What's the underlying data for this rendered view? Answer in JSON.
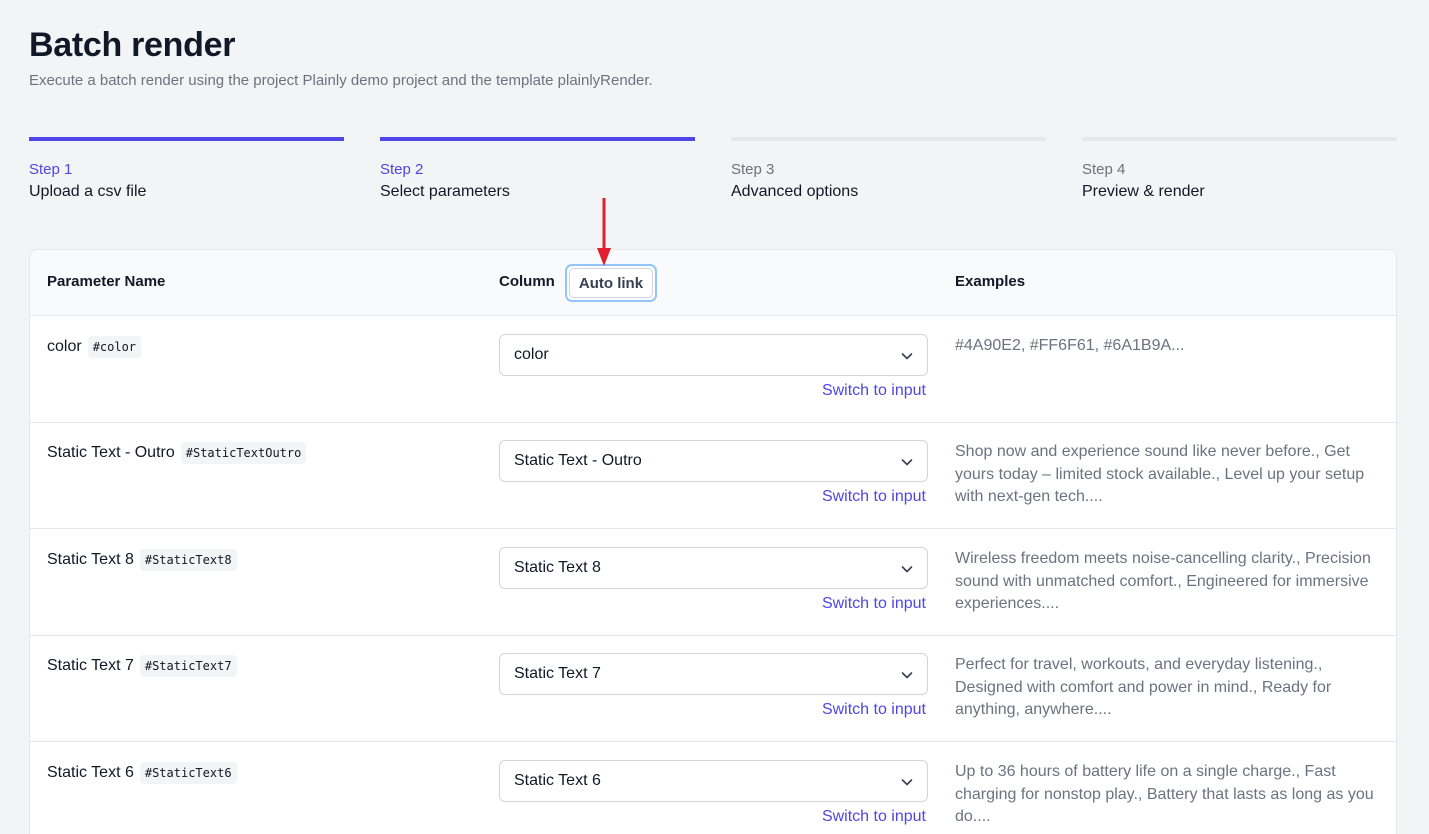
{
  "header": {
    "title": "Batch render",
    "subtitle": "Execute a batch render using the project Plainly demo project and the template plainlyRender."
  },
  "steps": [
    {
      "number": "Step 1",
      "name": "Upload a csv file",
      "state": "done"
    },
    {
      "number": "Step 2",
      "name": "Select parameters",
      "state": "active"
    },
    {
      "number": "Step 3",
      "name": "Advanced options",
      "state": "pending"
    },
    {
      "number": "Step 4",
      "name": "Preview & render",
      "state": "pending"
    }
  ],
  "table": {
    "headers": {
      "parameter": "Parameter Name",
      "column": "Column",
      "auto_link": "Auto link",
      "examples": "Examples"
    },
    "switch_label": "Switch to input",
    "rows": [
      {
        "name": "color",
        "tag": "#color",
        "value": "color",
        "examples": "#4A90E2, #FF6F61, #6A1B9A..."
      },
      {
        "name": "Static Text - Outro",
        "tag": "#StaticTextOutro",
        "value": "Static Text - Outro",
        "examples": "Shop now and experience sound like never before., Get yours today – limited stock available., Level up your setup with next-gen tech...."
      },
      {
        "name": "Static Text 8",
        "tag": "#StaticText8",
        "value": "Static Text 8",
        "examples": "Wireless freedom meets noise-cancelling clarity., Precision sound with unmatched comfort., Engineered for immersive experiences...."
      },
      {
        "name": "Static Text 7",
        "tag": "#StaticText7",
        "value": "Static Text 7",
        "examples": "Perfect for travel, workouts, and everyday listening., Designed with comfort and power in mind., Ready for anything, anywhere...."
      },
      {
        "name": "Static Text 6",
        "tag": "#StaticText6",
        "value": "Static Text 6",
        "examples": "Up to 36 hours of battery life on a single charge., Fast charging for nonstop play., Battery that lasts as long as you do...."
      }
    ]
  },
  "colors": {
    "accent": "#4f46e5",
    "annotation_arrow": "#e11d2e"
  }
}
